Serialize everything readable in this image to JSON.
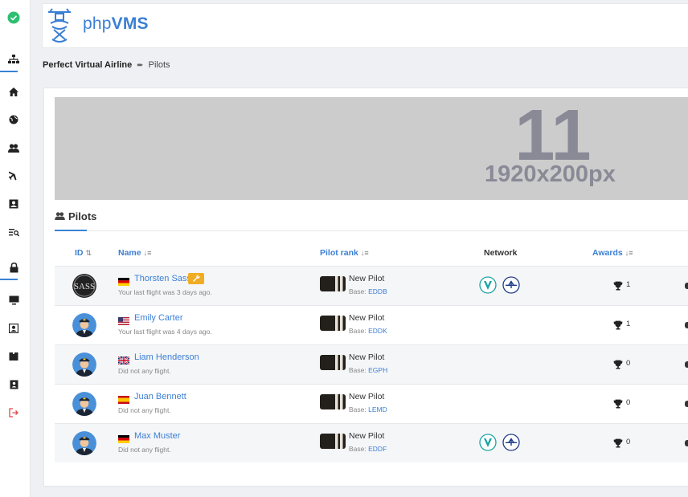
{
  "app": {
    "brand_light": "php",
    "brand_bold": "VMS"
  },
  "sidebar": {
    "items": [
      {
        "icon": "check-circle-icon"
      },
      {
        "icon": "sitemap-icon"
      },
      {
        "icon": "home-icon"
      },
      {
        "icon": "globe-icon"
      },
      {
        "icon": "users-icon"
      },
      {
        "icon": "plane-icon"
      },
      {
        "icon": "image-icon"
      },
      {
        "icon": "list-search-icon"
      },
      {
        "icon": "lock-icon"
      },
      {
        "icon": "monitor-icon"
      },
      {
        "icon": "profile-icon"
      },
      {
        "icon": "book-icon"
      },
      {
        "icon": "contact-card-icon"
      },
      {
        "icon": "logout-icon"
      }
    ]
  },
  "breadcrumb": {
    "home": "Perfect Virtual Airline",
    "current": "Pilots"
  },
  "banner": {
    "number": "11",
    "size": "1920x200px"
  },
  "section": {
    "title": "Pilots"
  },
  "table": {
    "headers": {
      "id": "ID",
      "name": "Name",
      "rank": "Pilot rank",
      "network": "Network",
      "awards": "Awards"
    },
    "rows": [
      {
        "name": "Thorsten Sass",
        "flag": "de",
        "staff": true,
        "last_flight": "Your last flight was 3 days ago.",
        "rank": "New Pilot",
        "base_label": "Base:",
        "base": "EDDB",
        "ivao": true,
        "vatsim": true,
        "awards": "1",
        "avatar": "sass"
      },
      {
        "name": "Emily Carter",
        "flag": "us",
        "staff": false,
        "last_flight": "Your last flight was 4 days ago.",
        "rank": "New Pilot",
        "base_label": "Base:",
        "base": "EDDK",
        "ivao": false,
        "vatsim": false,
        "awards": "1",
        "avatar": "pilot"
      },
      {
        "name": "Liam Henderson",
        "flag": "gb",
        "staff": false,
        "last_flight": "Did not any flight.",
        "rank": "New Pilot",
        "base_label": "Base:",
        "base": "EGPH",
        "ivao": false,
        "vatsim": false,
        "awards": "0",
        "avatar": "pilot"
      },
      {
        "name": "Juan Bennett",
        "flag": "es",
        "staff": false,
        "last_flight": "Did not any flight.",
        "rank": "New Pilot",
        "base_label": "Base:",
        "base": "LEMD",
        "ivao": false,
        "vatsim": false,
        "awards": "0",
        "avatar": "pilot"
      },
      {
        "name": "Max Muster",
        "flag": "de",
        "staff": false,
        "last_flight": "Did not any flight.",
        "rank": "New Pilot",
        "base_label": "Base:",
        "base": "EDDF",
        "ivao": true,
        "vatsim": true,
        "awards": "0",
        "avatar": "pilot"
      }
    ]
  },
  "colors": {
    "accent": "#3b7fd4",
    "staff_badge": "#f0ad23",
    "check": "#2fbf71",
    "logout": "#e04848"
  }
}
